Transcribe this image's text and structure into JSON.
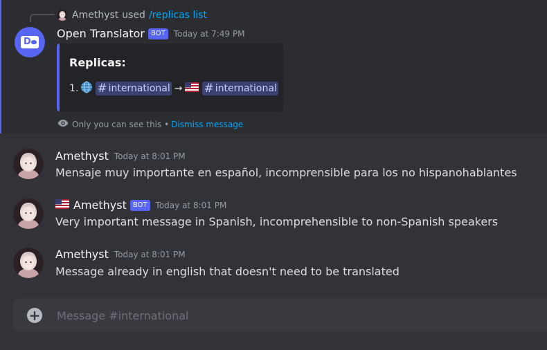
{
  "ephemeral": {
    "reply": {
      "user": "Amethyst",
      "action": "used",
      "command": "/replicas list"
    },
    "author": "Open Translator",
    "badge": "BOT",
    "timestamp": "Today at 7:49 PM",
    "embed": {
      "title": "Replicas:",
      "list_number": "1.",
      "source_channel": "international",
      "target_channel": "international",
      "arrow": "→"
    },
    "note": "Only you can see this •",
    "dismiss": "Dismiss message"
  },
  "messages": [
    {
      "author": "Amethyst",
      "timestamp": "Today at 8:01 PM",
      "text": "Mensaje muy importante en español, incomprensible para los no hispanohablantes"
    },
    {
      "author": "Amethyst",
      "badge": "BOT",
      "timestamp": "Today at 8:01 PM",
      "text": "Very important message in Spanish, incomprehensible to non-Spanish speakers"
    },
    {
      "author": "Amethyst",
      "timestamp": "Today at 8:01 PM",
      "text": "Message already in english that doesn't need to be translated"
    }
  ],
  "composer": {
    "placeholder": "Message #international"
  },
  "colors": {
    "background": "#313338",
    "accent": "#5865f2",
    "link": "#00a8fc"
  }
}
